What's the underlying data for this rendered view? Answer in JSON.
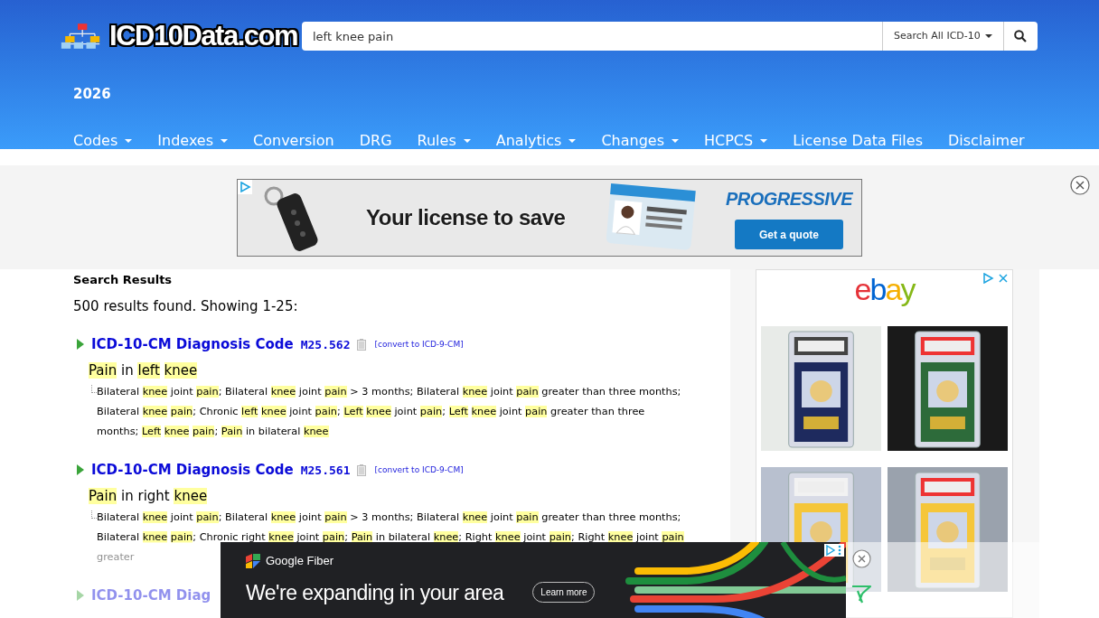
{
  "header": {
    "logo": "ICD10Data.com",
    "search": {
      "value": "left knee pain"
    },
    "search_scope": "Search All ICD-10",
    "year": "2026",
    "nav": [
      {
        "label": "Codes",
        "dropdown": true
      },
      {
        "label": "Indexes",
        "dropdown": true
      },
      {
        "label": "Conversion",
        "dropdown": false
      },
      {
        "label": "DRG",
        "dropdown": false
      },
      {
        "label": "Rules",
        "dropdown": true
      },
      {
        "label": "Analytics",
        "dropdown": true
      },
      {
        "label": "Changes",
        "dropdown": true
      },
      {
        "label": "HCPCS",
        "dropdown": true
      },
      {
        "label": "License Data Files",
        "dropdown": false
      },
      {
        "label": "Disclaimer",
        "dropdown": false
      }
    ]
  },
  "top_ad": {
    "headline": "Your license to save",
    "brand": "PROGRESSIVE",
    "button": "Get a quote"
  },
  "results": {
    "heading": "Search Results",
    "summary": "500 results found. Showing 1-25:",
    "items": [
      {
        "code_type": "ICD-10-CM Diagnosis Code",
        "code": "M25.562",
        "convert": "[convert to ICD-9-CM]",
        "title": [
          {
            "match": "Pain"
          },
          " in ",
          {
            "match": "left knee"
          }
        ],
        "description": [
          "Bilateral ",
          {
            "match": "knee"
          },
          " joint ",
          {
            "match": "pain"
          },
          "; Bilateral ",
          {
            "match": "knee"
          },
          " joint ",
          {
            "match": "pain"
          },
          " > 3 months; Bilateral ",
          {
            "match": "knee"
          },
          " joint ",
          {
            "match": "pain"
          },
          " greater than three months; Bilateral ",
          {
            "match": "knee pain"
          },
          "; Chronic ",
          {
            "match": "left knee"
          },
          " joint ",
          {
            "match": "pain"
          },
          "; ",
          {
            "match": "Left knee"
          },
          " joint ",
          {
            "match": "pain"
          },
          "; ",
          {
            "match": "Left knee"
          },
          " joint ",
          {
            "match": "pain"
          },
          " greater than three months; ",
          {
            "match": "Left knee pain"
          },
          "; ",
          {
            "match": "Pain"
          },
          " in bilateral ",
          {
            "match": "knee"
          }
        ]
      },
      {
        "code_type": "ICD-10-CM Diagnosis Code",
        "code": "M25.561",
        "convert": "[convert to ICD-9-CM]",
        "title": [
          {
            "match": "Pain"
          },
          " in right ",
          {
            "match": "knee"
          }
        ],
        "description": [
          "Bilateral ",
          {
            "match": "knee"
          },
          " joint ",
          {
            "match": "pain"
          },
          "; Bilateral ",
          {
            "match": "knee"
          },
          " joint ",
          {
            "match": "pain"
          },
          " > 3 months; Bilateral ",
          {
            "match": "knee"
          },
          " joint ",
          {
            "match": "pain"
          },
          " greater than three months; Bilateral ",
          {
            "match": "knee pain"
          },
          "; Chronic right ",
          {
            "match": "knee"
          },
          " joint ",
          {
            "match": "pain"
          },
          "; ",
          {
            "match": "Pain"
          },
          " in bilateral ",
          {
            "match": "knee"
          },
          "; Right ",
          {
            "match": "knee"
          },
          " joint ",
          {
            "match": "pain"
          },
          "; Right ",
          {
            "match": "knee"
          },
          " joint ",
          {
            "match": "pain"
          },
          " greater"
        ]
      },
      {
        "code_type": "ICD-10-CM Diag"
      }
    ]
  },
  "side_ad": {
    "brand": "ebay"
  },
  "bottom_ad": {
    "brand": "Google Fiber",
    "headline": "We're expanding in your area",
    "button": "Learn more"
  }
}
